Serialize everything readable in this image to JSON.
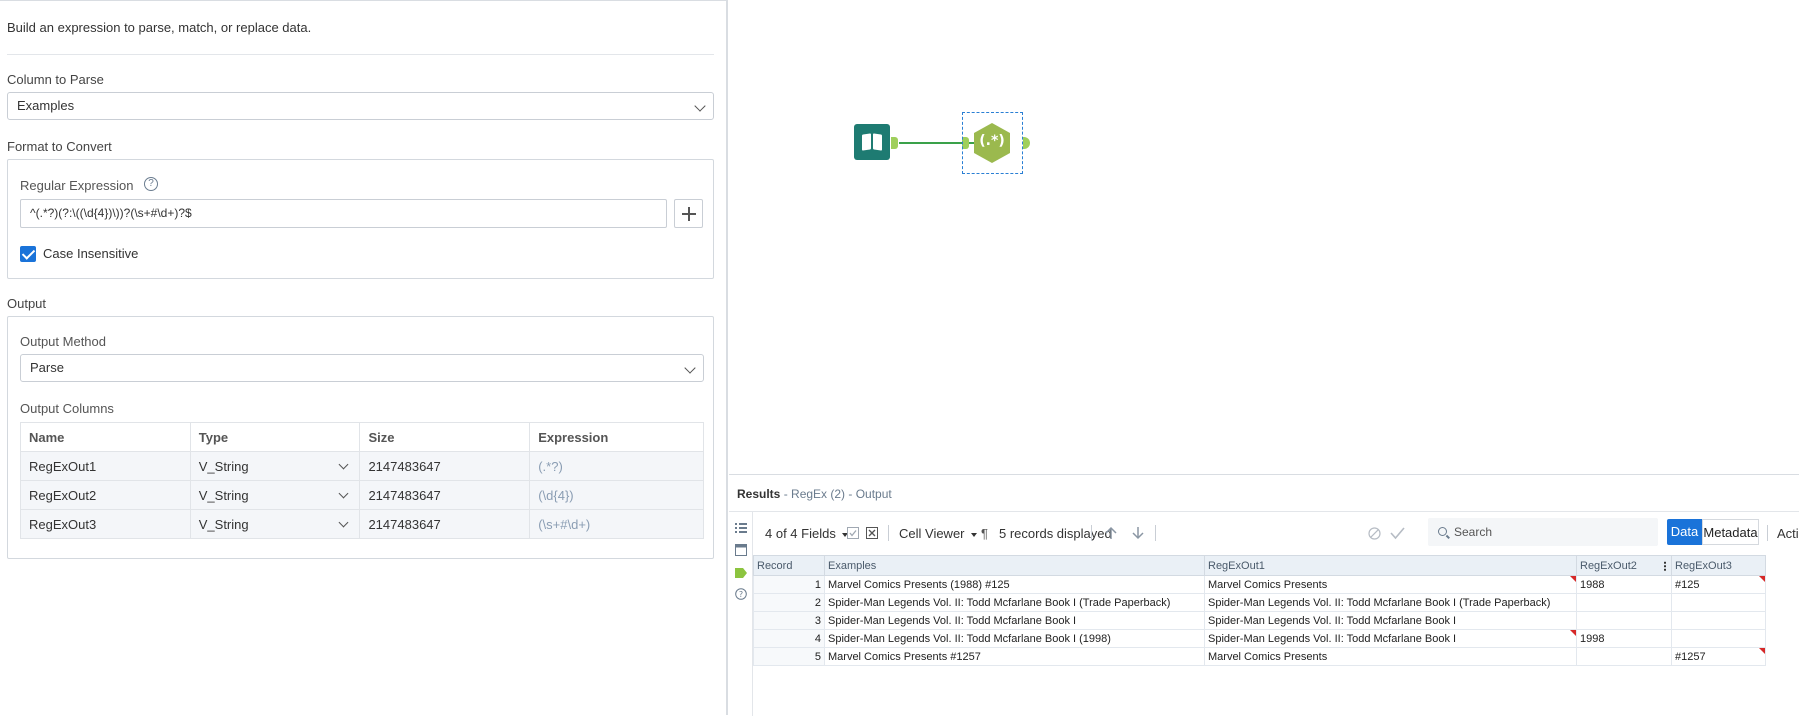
{
  "config": {
    "description": "Build an expression to parse, match, or replace data.",
    "column_to_parse_label": "Column to Parse",
    "column_to_parse_value": "Examples",
    "format_to_convert_label": "Format to Convert",
    "regex_label": "Regular Expression",
    "regex_help": "?",
    "regex_value": "^(.*?)(?:\\((\\d{4})\\))?(\\s+#\\d+)?$",
    "case_insensitive_label": "Case Insensitive",
    "case_insensitive_checked": true,
    "output_label": "Output",
    "output_method_label": "Output Method",
    "output_method_value": "Parse",
    "output_columns_label": "Output Columns",
    "columns_headers": [
      "Name",
      "Type",
      "Size",
      "Expression"
    ],
    "columns_rows": [
      {
        "name": "RegExOut1",
        "type": "V_String",
        "size": "2147483647",
        "expr": "(.*?)"
      },
      {
        "name": "RegExOut2",
        "type": "V_String",
        "size": "2147483647",
        "expr": "(\\d{4})"
      },
      {
        "name": "RegExOut3",
        "type": "V_String",
        "size": "2147483647",
        "expr": "(\\s+#\\d+)"
      }
    ]
  },
  "canvas": {
    "regex_tool_glyph": "(.*)",
    "input_tool_icon": "book-icon"
  },
  "results": {
    "title": "Results",
    "subtitle": "- RegEx (2) - Output",
    "fields_selector": "4 of 4 Fields",
    "cell_viewer": "Cell Viewer",
    "pilcrow": "¶",
    "records_displayed": "5 records displayed",
    "search_placeholder": "Search",
    "data_tab": "Data",
    "metadata_tab": "Metadata",
    "actions_label": "Actions",
    "grid_headers": [
      "Record",
      "Examples",
      "RegExOut1",
      "RegExOut2",
      "RegExOut3"
    ],
    "grid_rows": [
      {
        "rec": "1",
        "examples": "Marvel Comics Presents (1988) #125",
        "out1": "Marvel Comics Presents",
        "out2": "1988",
        "out3": "#125"
      },
      {
        "rec": "2",
        "examples": "Spider-Man Legends Vol. II: Todd Mcfarlane Book I (Trade Paperback)",
        "out1": "Spider-Man Legends Vol. II: Todd Mcfarlane Book I (Trade Paperback)",
        "out2": "",
        "out3": ""
      },
      {
        "rec": "3",
        "examples": "Spider-Man Legends Vol. II: Todd Mcfarlane Book I",
        "out1": "Spider-Man Legends Vol. II: Todd Mcfarlane Book I",
        "out2": "",
        "out3": ""
      },
      {
        "rec": "4",
        "examples": "Spider-Man Legends Vol. II: Todd Mcfarlane Book I (1998)",
        "out1": "Spider-Man Legends Vol. II: Todd Mcfarlane Book I",
        "out2": "1998",
        "out3": ""
      },
      {
        "rec": "5",
        "examples": "Marvel Comics Presents #1257",
        "out1": "Marvel Comics Presents",
        "out2": "",
        "out3": "#1257"
      }
    ],
    "colors": {
      "accent": "#1a73d9",
      "flag": "#d62828",
      "input_tool": "#1e7b72",
      "regex_tool": "#9bb94e"
    }
  }
}
